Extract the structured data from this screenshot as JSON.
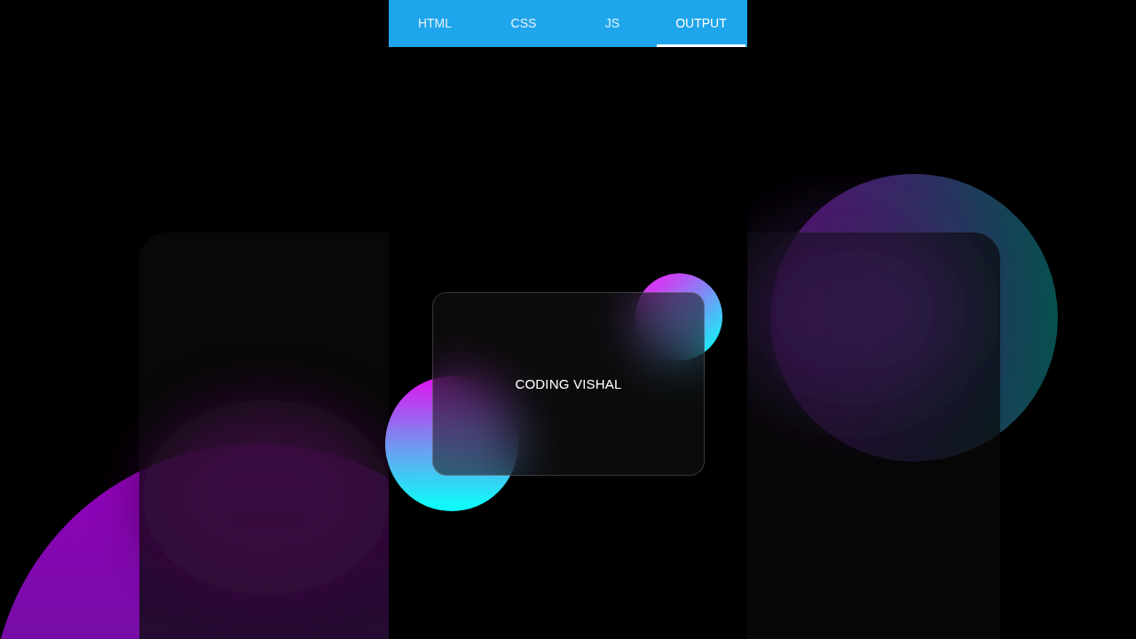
{
  "tabs": [
    {
      "label": "HTML",
      "selected": false
    },
    {
      "label": "CSS",
      "selected": false
    },
    {
      "label": "JS",
      "selected": false
    },
    {
      "label": "OUTPUT",
      "selected": true
    }
  ],
  "output": {
    "card": {
      "title": "CODING VISHAL"
    }
  }
}
